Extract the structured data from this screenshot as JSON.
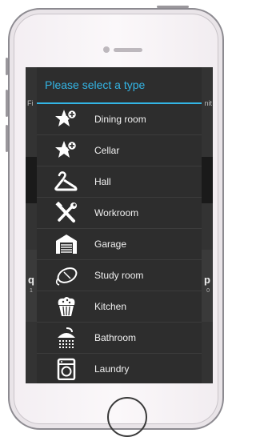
{
  "dialog": {
    "title": "Please select a type",
    "items": [
      {
        "label": "Dining room",
        "icon": "star-plus-icon"
      },
      {
        "label": "Cellar",
        "icon": "star-plus-icon"
      },
      {
        "label": "Hall",
        "icon": "hanger-icon"
      },
      {
        "label": "Workroom",
        "icon": "tools-icon"
      },
      {
        "label": "Garage",
        "icon": "garage-icon"
      },
      {
        "label": "Study room",
        "icon": "mouse-icon"
      },
      {
        "label": "Kitchen",
        "icon": "muffin-icon"
      },
      {
        "label": "Bathroom",
        "icon": "shower-icon"
      },
      {
        "label": "Laundry",
        "icon": "washing-machine-icon"
      }
    ]
  },
  "background": {
    "left_cut": "Fi",
    "right_cut": "nit",
    "key_q": "q",
    "key_q_sub": "1",
    "key_p": "p",
    "key_p_sub": "0"
  },
  "colors": {
    "accent": "#33b5e5",
    "dialog_bg": "#2d2d2d",
    "text": "#f0f0f0"
  }
}
